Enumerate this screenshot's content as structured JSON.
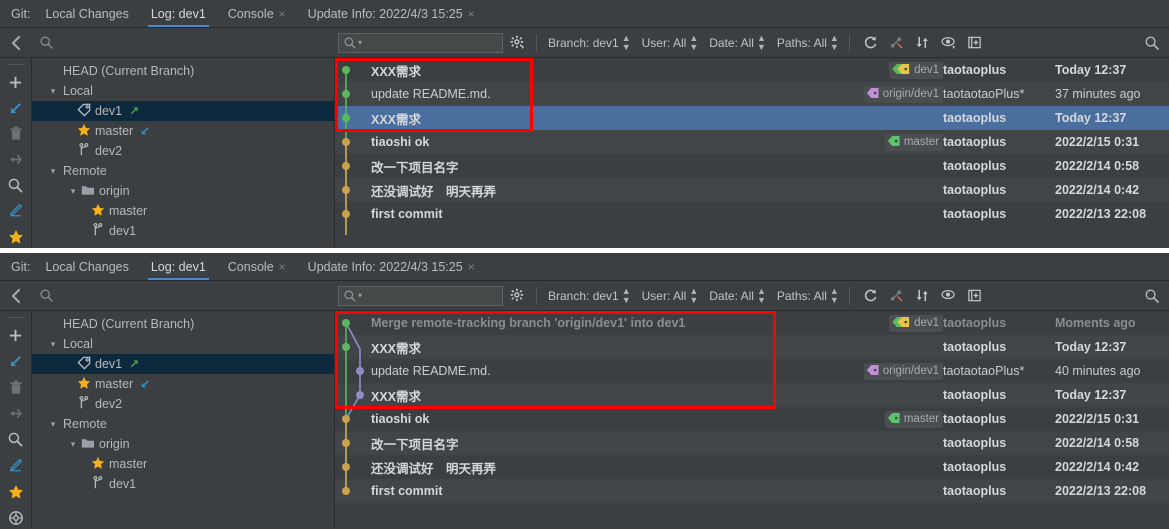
{
  "tabs": {
    "git_label": "Git:",
    "items": [
      {
        "label": "Local Changes",
        "closable": false,
        "active": false
      },
      {
        "label": "Log: dev1",
        "closable": false,
        "active": true
      },
      {
        "label": "Console",
        "closable": true,
        "active": false
      },
      {
        "label": "Update Info: 2022/4/3 15:25",
        "closable": true,
        "active": false
      }
    ],
    "close_glyph": "×"
  },
  "toolbar": {
    "back_icon": "‹",
    "search_placeholder": "",
    "input_icon": "search-dropdown-icon",
    "gear_icon": "gear-icon",
    "filters": [
      {
        "name": "branch-filter",
        "label": "Branch: dev1"
      },
      {
        "name": "user-filter",
        "label": "User: All"
      },
      {
        "name": "date-filter",
        "label": "Date: All"
      },
      {
        "name": "paths-filter",
        "label": "Paths: All"
      }
    ],
    "icons": [
      {
        "name": "refresh-icon"
      },
      {
        "name": "collapse-graph-icon"
      },
      {
        "name": "sort-icon"
      },
      {
        "name": "show-hide-icon"
      },
      {
        "name": "intellisort-icon"
      }
    ],
    "right_search_icon": "search-icon"
  },
  "vtoolbar": {
    "top_items": [
      {
        "name": "add-branch-icon",
        "glyph": "+"
      },
      {
        "name": "checkout-icon",
        "glyph": "↙"
      },
      {
        "name": "delete-icon",
        "glyph": "trash"
      },
      {
        "name": "merge-icon",
        "glyph": "merge"
      },
      {
        "name": "search-icon",
        "glyph": "search"
      },
      {
        "name": "rename-icon",
        "glyph": "pencil"
      },
      {
        "name": "favorite-icon",
        "glyph": "★"
      }
    ],
    "bottom_extra": {
      "name": "settings-wheel-icon",
      "glyph": "wheel"
    }
  },
  "tree": {
    "nodes": [
      {
        "label": "HEAD (Current Branch)",
        "indent": 0,
        "chevron": "",
        "icon": "",
        "selected": false,
        "arrow": ""
      },
      {
        "label": "Local",
        "indent": 1,
        "chevron": "∨",
        "icon": "",
        "selected": false,
        "arrow": ""
      },
      {
        "label": "dev1",
        "indent": 2,
        "chevron": "",
        "icon": "tag",
        "selected": true,
        "arrow": "up"
      },
      {
        "label": "master",
        "indent": 2,
        "chevron": "",
        "icon": "star",
        "selected": false,
        "arrow": "down"
      },
      {
        "label": "dev2",
        "indent": 2,
        "chevron": "",
        "icon": "branch",
        "selected": false,
        "arrow": ""
      },
      {
        "label": "Remote",
        "indent": 1,
        "chevron": "∨",
        "icon": "",
        "selected": false,
        "arrow": ""
      },
      {
        "label": "origin",
        "indent": 3,
        "chevron": "∨",
        "icon": "folder",
        "selected": false,
        "arrow": ""
      },
      {
        "label": "master",
        "indent": 4,
        "chevron": "",
        "icon": "star",
        "selected": false,
        "arrow": ""
      },
      {
        "label": "dev1",
        "indent": 4,
        "chevron": "",
        "icon": "branch",
        "selected": false,
        "arrow": ""
      }
    ]
  },
  "top_panel": {
    "commits": [
      {
        "subject": "XXX需求",
        "author": "taotaoplus",
        "date": "Today 12:37",
        "refs": [
          {
            "label": "dev1",
            "color": "#e8c44a",
            "kind": "local"
          }
        ],
        "style": "bold",
        "selected": false,
        "alt": false
      },
      {
        "subject": "update README.md.",
        "author": "taotaotaoPlus*",
        "date": "37 minutes ago",
        "refs": [
          {
            "label": "origin/dev1",
            "color": "#c08fd8",
            "kind": "remote"
          }
        ],
        "style": "plain",
        "selected": false,
        "alt": true
      },
      {
        "subject": "XXX需求",
        "author": "taotaoplus",
        "date": "Today 12:37",
        "refs": [],
        "style": "bold",
        "selected": true,
        "alt": false
      },
      {
        "subject": "tiaoshi ok",
        "author": "taotaoplus",
        "date": "2022/2/15 0:31",
        "refs": [
          {
            "label": "master",
            "color": "#5cc46a",
            "kind": "remote"
          }
        ],
        "style": "bold",
        "selected": false,
        "alt": true
      },
      {
        "subject": "改一下项目名字",
        "author": "taotaoplus",
        "date": "2022/2/14 0:58",
        "refs": [],
        "style": "bold",
        "selected": false,
        "alt": false
      },
      {
        "subject": "还没调试好　明天再弄",
        "author": "taotaoplus",
        "date": "2022/2/14 0:42",
        "refs": [],
        "style": "bold",
        "selected": false,
        "alt": true
      },
      {
        "subject": "first commit",
        "author": "taotaoplus",
        "date": "2022/2/13 22:08",
        "refs": [],
        "style": "bold",
        "selected": false,
        "alt": false
      }
    ]
  },
  "bottom_panel": {
    "commits": [
      {
        "subject": "Merge remote-tracking branch 'origin/dev1' into dev1",
        "author": "taotaoplus",
        "date": "Moments ago",
        "refs": [
          {
            "label": "dev1",
            "color": "#e8c44a",
            "kind": "local"
          }
        ],
        "style": "dim",
        "selected": false,
        "alt": false
      },
      {
        "subject": "XXX需求",
        "author": "taotaoplus",
        "date": "Today 12:37",
        "refs": [],
        "style": "bold",
        "selected": false,
        "alt": true
      },
      {
        "subject": "update README.md.",
        "author": "taotaotaoPlus*",
        "date": "40 minutes ago",
        "refs": [
          {
            "label": "origin/dev1",
            "color": "#c08fd8",
            "kind": "remote"
          }
        ],
        "style": "plain",
        "selected": false,
        "alt": false
      },
      {
        "subject": "XXX需求",
        "author": "taotaoplus",
        "date": "Today 12:37",
        "refs": [],
        "style": "bold",
        "selected": false,
        "alt": true
      },
      {
        "subject": "tiaoshi ok",
        "author": "taotaoplus",
        "date": "2022/2/15 0:31",
        "refs": [
          {
            "label": "master",
            "color": "#5cc46a",
            "kind": "remote"
          }
        ],
        "style": "bold",
        "selected": false,
        "alt": false
      },
      {
        "subject": "改一下项目名字",
        "author": "taotaoplus",
        "date": "2022/2/14 0:58",
        "refs": [],
        "style": "bold",
        "selected": false,
        "alt": true
      },
      {
        "subject": "还没调试好　明天再弄",
        "author": "taotaoplus",
        "date": "2022/2/14 0:42",
        "refs": [],
        "style": "bold",
        "selected": false,
        "alt": false
      },
      {
        "subject": "first commit",
        "author": "taotaoplus",
        "date": "2022/2/13 22:08",
        "refs": [],
        "style": "bold",
        "selected": false,
        "alt": true
      }
    ]
  },
  "colors": {
    "accent_blue": "#4a88c7",
    "selection_blue": "#4a6f9e",
    "tree_selection": "#0d293e",
    "graph_green": "#5cb85c",
    "graph_orange": "#c9a24d",
    "graph_purple": "#8f8fc8",
    "highlight_red": "#ff0000",
    "panel_bg": "#3c3f41",
    "row_alt": "#414548"
  }
}
